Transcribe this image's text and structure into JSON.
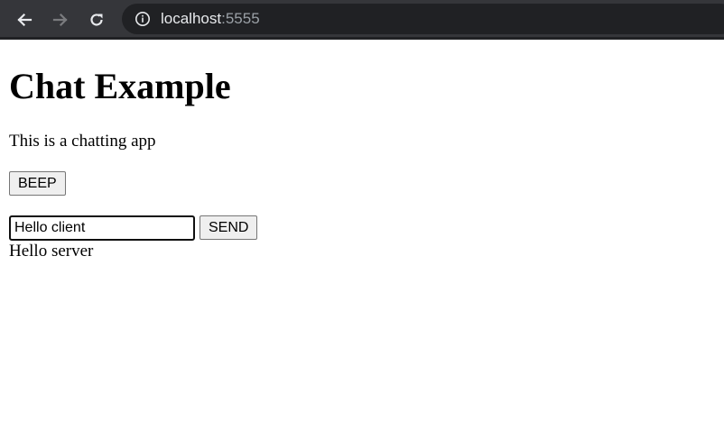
{
  "browser": {
    "url_host": "localhost",
    "url_port": ":5555"
  },
  "page": {
    "title": "Chat Example",
    "description": "This is a chatting app",
    "beep_button_label": "BEEP",
    "message_input_value": "Hello client",
    "send_button_label": "SEND",
    "messages": [
      "Hello server"
    ]
  },
  "icons": {
    "back": "arrow-left-icon",
    "forward": "arrow-right-icon",
    "reload": "reload-icon",
    "site_info": "info-icon"
  }
}
